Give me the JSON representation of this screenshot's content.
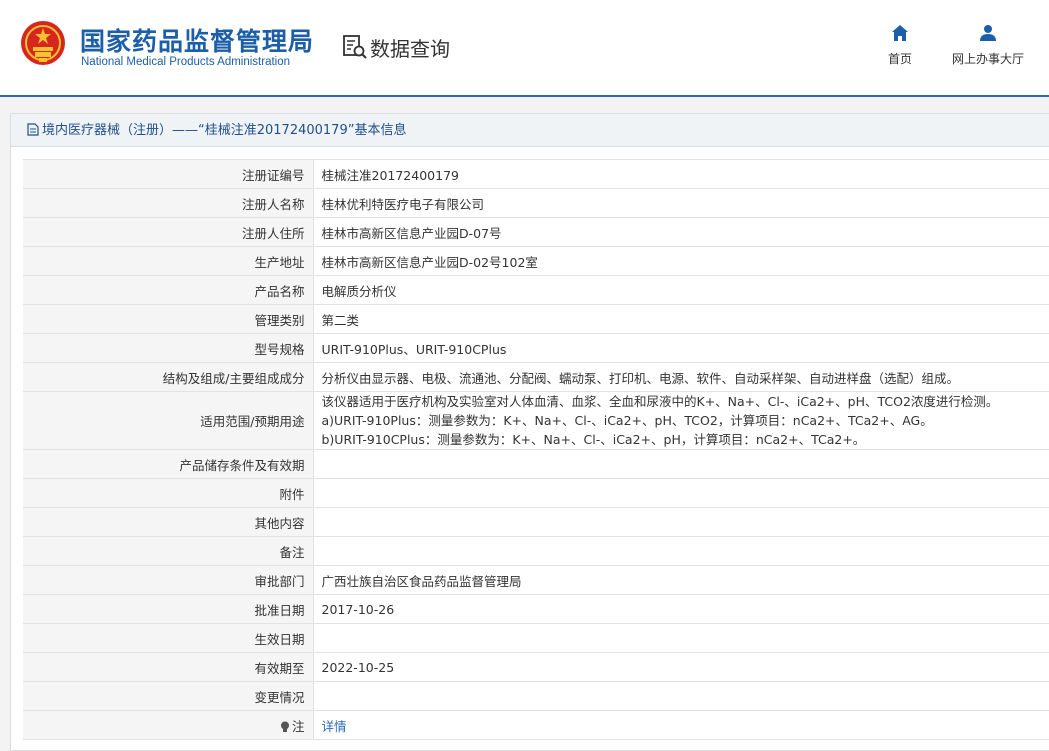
{
  "header": {
    "org_name_cn": "国家药品监督管理局",
    "org_name_en": "National Medical Products Administration",
    "section_label": "数据查询",
    "nav": [
      {
        "label": "首页",
        "icon": "home-icon"
      },
      {
        "label": "网上办事大厅",
        "icon": "user-icon"
      }
    ]
  },
  "panel": {
    "title": "境内医疗器械（注册）——“桂械注准20172400179”基本信息"
  },
  "rows": [
    {
      "key": "注册证编号",
      "value": "桂械注准20172400179"
    },
    {
      "key": "注册人名称",
      "value": "桂林优利特医疗电子有限公司"
    },
    {
      "key": "注册人住所",
      "value": "桂林市高新区信息产业园D-07号"
    },
    {
      "key": "生产地址",
      "value": "桂林市高新区信息产业园D-02号102室"
    },
    {
      "key": "产品名称",
      "value": "电解质分析仪"
    },
    {
      "key": "管理类别",
      "value": "第二类"
    },
    {
      "key": "型号规格",
      "value": "URIT-910Plus、URIT-910CPlus"
    },
    {
      "key": "结构及组成/主要组成成分",
      "value": "分析仪由显示器、电极、流通池、分配阀、蠕动泵、打印机、电源、软件、自动采样架、自动进样盘（选配）组成。"
    },
    {
      "key": "适用范围/预期用途",
      "lines": [
        "该仪器适用于医疗机构及实验室对人体血清、血浆、全血和尿液中的K+、Na+、Cl-、iCa2+、pH、TCO2浓度进行检测。",
        "a)URIT-910Plus：测量参数为：K+、Na+、Cl-、iCa2+、pH、TCO2，计算项目：nCa2+、TCa2+、AG。",
        "b)URIT-910CPlus：测量参数为：K+、Na+、Cl-、iCa2+、pH，计算项目：nCa2+、TCa2+。"
      ]
    },
    {
      "key": "产品储存条件及有效期",
      "value": ""
    },
    {
      "key": "附件",
      "value": ""
    },
    {
      "key": "其他内容",
      "value": ""
    },
    {
      "key": "备注",
      "value": ""
    },
    {
      "key": "审批部门",
      "value": "广西壮族自治区食品药品监督管理局"
    },
    {
      "key": "批准日期",
      "value": "2017-10-26"
    },
    {
      "key": "生效日期",
      "value": ""
    },
    {
      "key": "有效期至",
      "value": "2022-10-25"
    },
    {
      "key": "变更情况",
      "value": ""
    },
    {
      "key": "注",
      "value": "详情",
      "link": true,
      "icon": "bulb-icon"
    }
  ],
  "colors": {
    "brand": "#1c5fa8",
    "link": "#2a6bb5",
    "key_bg": "#f5f5f5"
  }
}
